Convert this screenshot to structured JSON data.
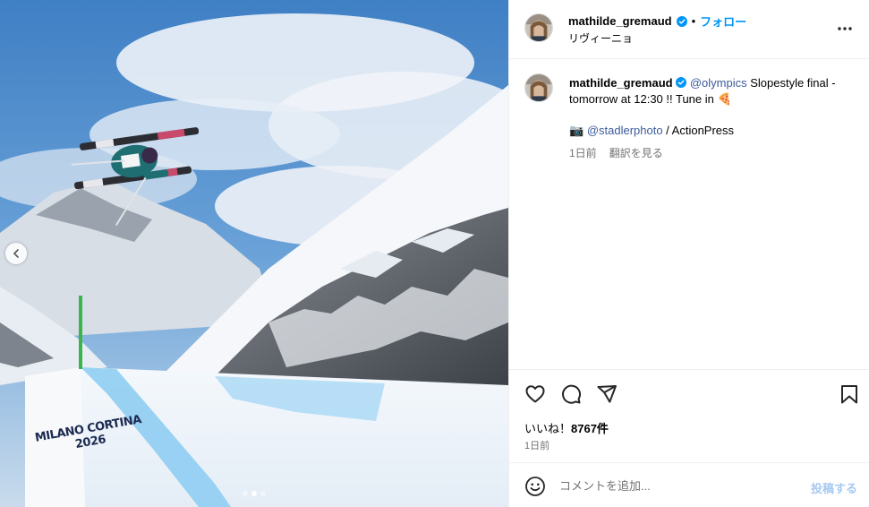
{
  "media": {
    "watermark_line1": "MILANO CORTINA",
    "watermark_line2": "2026",
    "carousel_total": 3,
    "carousel_active": 2,
    "prev_icon": "chevron-left-icon"
  },
  "header": {
    "username": "mathilde_gremaud",
    "separator": "•",
    "follow_label": "フォロー",
    "location": "リヴィーニョ",
    "verified_icon": "verified-badge-icon",
    "more_icon": "more-horizontal-icon"
  },
  "caption": {
    "username": "mathilde_gremaud",
    "mention": "@olympics",
    "text": " Slopestyle final - tomorrow at 12:30 !! Tune in ",
    "emoji": "🍕",
    "camera_emoji": "📷",
    "credit_mention": "@stadlerphoto",
    "credit_rest": " / ActionPress",
    "time_ago": "1日前",
    "translate_label": "翻訳を見る"
  },
  "actions": {
    "like_icon": "heart-icon",
    "comment_icon": "comment-icon",
    "share_icon": "send-icon",
    "save_icon": "bookmark-icon",
    "likes_prefix": "いいね！",
    "likes_count": "8767件",
    "date": "1日前"
  },
  "add_comment": {
    "placeholder": "コメントを追加...",
    "post_label": "投稿する",
    "emoji_icon": "emoji-smile-icon"
  },
  "colors": {
    "accent": "#0095f6",
    "link": "#3d5a9a",
    "post_disabled": "#a6c9f2",
    "sky": "#4a86c8",
    "ramp_blue": "#7fc3ee"
  }
}
